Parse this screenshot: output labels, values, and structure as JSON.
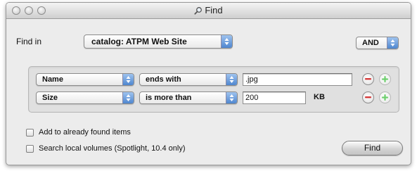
{
  "window": {
    "title": "Find"
  },
  "find_in": {
    "label": "Find in",
    "selected": "catalog: ATPM Web Site"
  },
  "logic": {
    "selected": "AND"
  },
  "criteria": [
    {
      "field": "Name",
      "operator": "ends with",
      "value": ".jpg",
      "unit": ""
    },
    {
      "field": "Size",
      "operator": "is more than",
      "value": "200",
      "unit": "KB"
    }
  ],
  "options": {
    "add_found": "Add to already found items",
    "search_local": "Search local volumes (Spotlight, 10.4 only)"
  },
  "buttons": {
    "find": "Find"
  },
  "colors": {
    "popup_arrow_accent": "#4f86cf",
    "minus_red": "#d63a3a",
    "plus_green": "#6fcf6f"
  }
}
